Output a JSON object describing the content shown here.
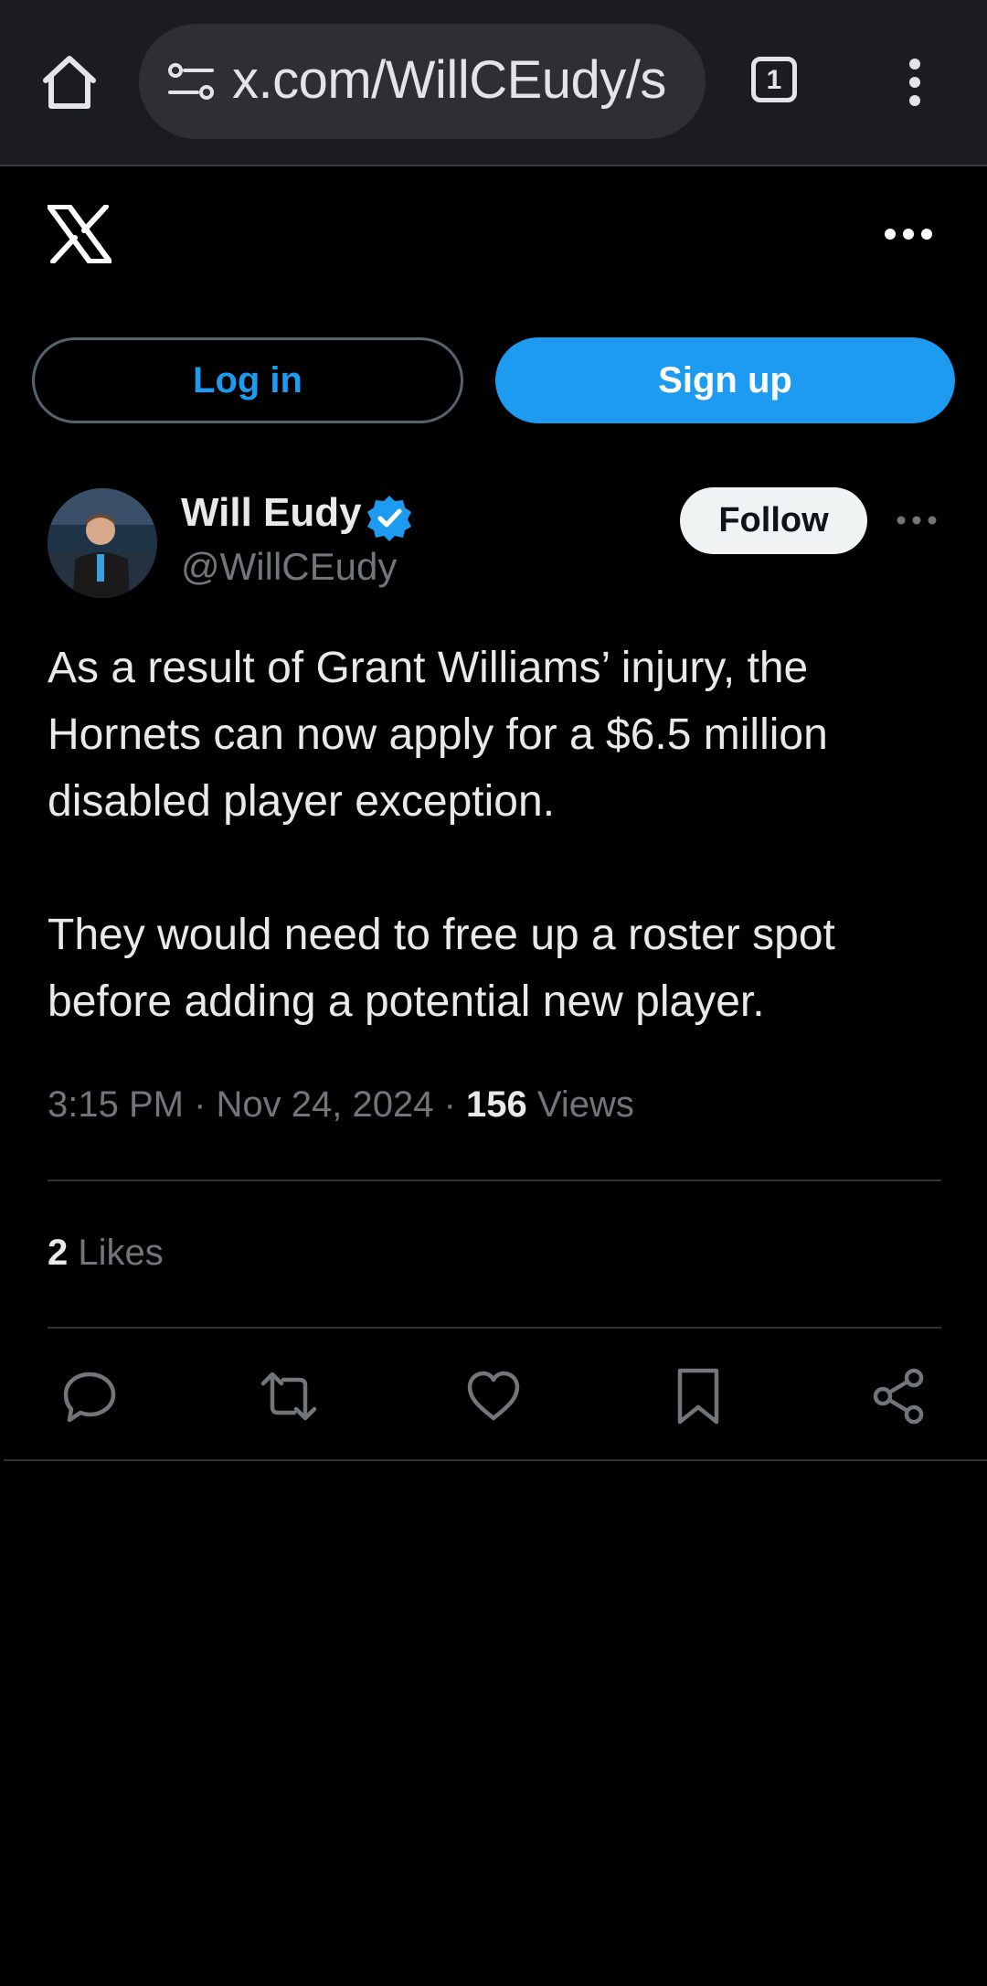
{
  "browser": {
    "url": "x.com/WillCEudy/s",
    "tab_count": "1"
  },
  "auth": {
    "login_label": "Log in",
    "signup_label": "Sign up"
  },
  "tweet": {
    "author_name": "Will Eudy",
    "author_handle": "@WillCEudy",
    "follow_label": "Follow",
    "paragraphs": [
      "As a result of Grant Williams’ injury, the Hornets can now apply for a $6.5 million disabled player exception.",
      "They would need to free up a roster spot before adding a potential new player."
    ],
    "time": "3:15 PM",
    "date": "Nov 24, 2024",
    "views_count": "156",
    "views_label": "Views",
    "likes_count": "2",
    "likes_label": "Likes"
  },
  "colors": {
    "accent": "#1d9bf0",
    "background": "#000000",
    "muted_text": "#71767b"
  }
}
